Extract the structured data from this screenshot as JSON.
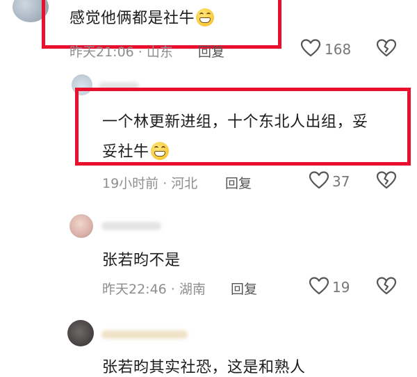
{
  "comments": [
    {
      "text": "感觉他俩都是社牛",
      "meta": "昨天21:06 · 山东",
      "reply_label": "回复",
      "likes": "168"
    },
    {
      "text_line1": "一个林更新进组，十个东北人出组，妥",
      "text_line2": "妥社牛",
      "meta": "19小时前 · 河北",
      "reply_label": "回复",
      "likes": "37"
    },
    {
      "text": "张若昀不是",
      "meta": "昨天22:46 · 湖南",
      "reply_label": "回复",
      "likes": "19"
    },
    {
      "text": "张若昀其实社恐，这是和熟人"
    }
  ],
  "icons": {
    "like": "heart-outline-icon",
    "dislike": "broken-heart-icon",
    "emoji": "grinning-face-emoji"
  },
  "colors": {
    "highlight_box": "#e8102c",
    "meta_text": "#8e8e8e"
  }
}
